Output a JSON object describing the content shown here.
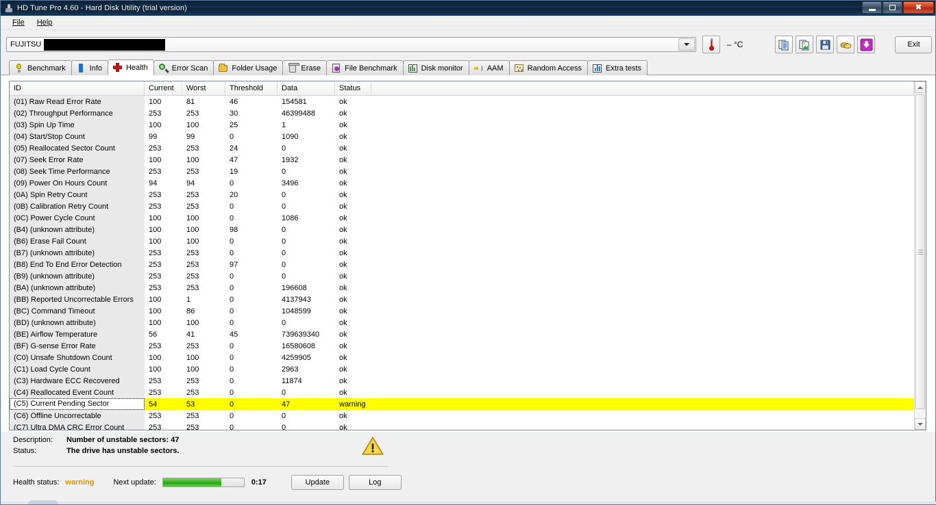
{
  "window": {
    "title": "HD Tune Pro 4.60 - Hard Disk Utility (trial version)",
    "app_icon": "hdd-icon",
    "minimize": "minimize-icon",
    "maximize": "maximize-icon",
    "close": "close-icon"
  },
  "menu": {
    "items": [
      {
        "label": "File"
      },
      {
        "label": "Help"
      }
    ]
  },
  "toolbar": {
    "drive_name": "FUJITSU",
    "drive_model_redacted": true,
    "temperature": "– °C",
    "thermometer_icon": "thermometer-icon",
    "icons": [
      {
        "name": "copy-icon"
      },
      {
        "name": "copy-image-icon"
      },
      {
        "name": "save-icon"
      },
      {
        "name": "gloves-icon"
      },
      {
        "name": "download-icon"
      }
    ],
    "exit_label": "Exit"
  },
  "tabs": [
    {
      "label": "Benchmark",
      "icon": "bulb-icon",
      "active": false
    },
    {
      "label": "Info",
      "icon": "info-icon",
      "active": false
    },
    {
      "label": "Health",
      "icon": "red-cross-icon",
      "active": true
    },
    {
      "label": "Error Scan",
      "icon": "magnifier-icon",
      "active": false
    },
    {
      "label": "Folder Usage",
      "icon": "folder-icon",
      "active": false
    },
    {
      "label": "Erase",
      "icon": "trash-icon",
      "active": false
    },
    {
      "label": "File Benchmark",
      "icon": "file-benchmark-icon",
      "active": false
    },
    {
      "label": "Disk monitor",
      "icon": "bar-chart-icon",
      "active": false
    },
    {
      "label": "AAM",
      "icon": "speaker-icon",
      "active": false
    },
    {
      "label": "Random Access",
      "icon": "dots-icon",
      "active": false
    },
    {
      "label": "Extra tests",
      "icon": "extra-chart-icon",
      "active": false
    }
  ],
  "table": {
    "columns": [
      "ID",
      "Current",
      "Worst",
      "Threshold",
      "Data",
      "Status"
    ],
    "rows": [
      {
        "id": "(01) Raw Read Error Rate",
        "current": "100",
        "worst": "81",
        "threshold": "46",
        "data": "154581",
        "status": "ok",
        "warn": false
      },
      {
        "id": "(02) Throughput Performance",
        "current": "253",
        "worst": "253",
        "threshold": "30",
        "data": "46399488",
        "status": "ok",
        "warn": false
      },
      {
        "id": "(03) Spin Up Time",
        "current": "100",
        "worst": "100",
        "threshold": "25",
        "data": "1",
        "status": "ok",
        "warn": false
      },
      {
        "id": "(04) Start/Stop Count",
        "current": "99",
        "worst": "99",
        "threshold": "0",
        "data": "1090",
        "status": "ok",
        "warn": false
      },
      {
        "id": "(05) Reallocated Sector Count",
        "current": "253",
        "worst": "253",
        "threshold": "24",
        "data": "0",
        "status": "ok",
        "warn": false
      },
      {
        "id": "(07) Seek Error Rate",
        "current": "100",
        "worst": "100",
        "threshold": "47",
        "data": "1932",
        "status": "ok",
        "warn": false
      },
      {
        "id": "(08) Seek Time Performance",
        "current": "253",
        "worst": "253",
        "threshold": "19",
        "data": "0",
        "status": "ok",
        "warn": false
      },
      {
        "id": "(09) Power On Hours Count",
        "current": "94",
        "worst": "94",
        "threshold": "0",
        "data": "3496",
        "status": "ok",
        "warn": false
      },
      {
        "id": "(0A) Spin Retry Count",
        "current": "253",
        "worst": "253",
        "threshold": "20",
        "data": "0",
        "status": "ok",
        "warn": false
      },
      {
        "id": "(0B) Calibration Retry Count",
        "current": "253",
        "worst": "253",
        "threshold": "0",
        "data": "0",
        "status": "ok",
        "warn": false
      },
      {
        "id": "(0C) Power Cycle Count",
        "current": "100",
        "worst": "100",
        "threshold": "0",
        "data": "1086",
        "status": "ok",
        "warn": false
      },
      {
        "id": "(B4) (unknown attribute)",
        "current": "100",
        "worst": "100",
        "threshold": "98",
        "data": "0",
        "status": "ok",
        "warn": false
      },
      {
        "id": "(B6) Erase Fail Count",
        "current": "100",
        "worst": "100",
        "threshold": "0",
        "data": "0",
        "status": "ok",
        "warn": false
      },
      {
        "id": "(B7) (unknown attribute)",
        "current": "253",
        "worst": "253",
        "threshold": "0",
        "data": "0",
        "status": "ok",
        "warn": false
      },
      {
        "id": "(B8) End To End Error Detection",
        "current": "253",
        "worst": "253",
        "threshold": "97",
        "data": "0",
        "status": "ok",
        "warn": false
      },
      {
        "id": "(B9) (unknown attribute)",
        "current": "253",
        "worst": "253",
        "threshold": "0",
        "data": "0",
        "status": "ok",
        "warn": false
      },
      {
        "id": "(BA) (unknown attribute)",
        "current": "253",
        "worst": "253",
        "threshold": "0",
        "data": "196608",
        "status": "ok",
        "warn": false
      },
      {
        "id": "(BB) Reported Uncorrectable Errors",
        "current": "100",
        "worst": "1",
        "threshold": "0",
        "data": "4137943",
        "status": "ok",
        "warn": false
      },
      {
        "id": "(BC) Command Timeout",
        "current": "100",
        "worst": "86",
        "threshold": "0",
        "data": "1048599",
        "status": "ok",
        "warn": false
      },
      {
        "id": "(BD) (unknown attribute)",
        "current": "100",
        "worst": "100",
        "threshold": "0",
        "data": "0",
        "status": "ok",
        "warn": false
      },
      {
        "id": "(BE) Airflow Temperature",
        "current": "56",
        "worst": "41",
        "threshold": "45",
        "data": "739639340",
        "status": "ok",
        "warn": false
      },
      {
        "id": "(BF) G-sense Error Rate",
        "current": "253",
        "worst": "253",
        "threshold": "0",
        "data": "16580608",
        "status": "ok",
        "warn": false
      },
      {
        "id": "(C0) Unsafe Shutdown Count",
        "current": "100",
        "worst": "100",
        "threshold": "0",
        "data": "4259905",
        "status": "ok",
        "warn": false
      },
      {
        "id": "(C1) Load Cycle Count",
        "current": "100",
        "worst": "100",
        "threshold": "0",
        "data": "2963",
        "status": "ok",
        "warn": false
      },
      {
        "id": "(C3) Hardware ECC Recovered",
        "current": "253",
        "worst": "253",
        "threshold": "0",
        "data": "11874",
        "status": "ok",
        "warn": false
      },
      {
        "id": "(C4) Reallocated Event Count",
        "current": "253",
        "worst": "253",
        "threshold": "0",
        "data": "0",
        "status": "ok",
        "warn": false
      },
      {
        "id": "(C5) Current Pending Sector",
        "current": "54",
        "worst": "53",
        "threshold": "0",
        "data": "47",
        "status": "warning",
        "warn": true
      },
      {
        "id": "(C6) Offline Uncorrectable",
        "current": "253",
        "worst": "253",
        "threshold": "0",
        "data": "0",
        "status": "ok",
        "warn": false
      },
      {
        "id": "(C7) Ultra DMA CRC Error Count",
        "current": "253",
        "worst": "253",
        "threshold": "0",
        "data": "0",
        "status": "ok",
        "warn": false
      }
    ]
  },
  "description_panel": {
    "description_label": "Description:",
    "description_value": "Number of unstable sectors: 47",
    "status_label": "Status:",
    "status_value": "The drive has unstable sectors.",
    "warning_icon": "warning-triangle-icon"
  },
  "statusbar": {
    "health_label": "Health status:",
    "health_value": "warning",
    "health_color": "#d99500",
    "next_update_label": "Next update:",
    "progress_percent": 72,
    "progress_color": "#34b021",
    "timer": "0:17",
    "update_label": "Update",
    "log_label": "Log"
  }
}
